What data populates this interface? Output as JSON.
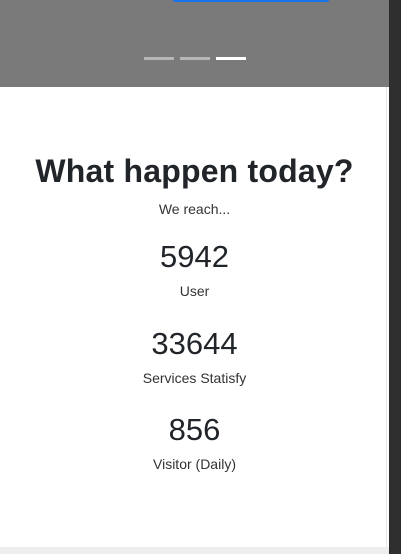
{
  "hero": {
    "slides": 3,
    "active_slide": 3
  },
  "stats": {
    "title": "What happen today?",
    "subtitle": "We reach...",
    "items": [
      {
        "value": "5942",
        "label": "User"
      },
      {
        "value": "33644",
        "label": "Services Statisfy"
      },
      {
        "value": "856",
        "label": "Visitor (Daily)"
      }
    ]
  },
  "colors": {
    "hero_bg": "#7a7a7a",
    "cta_blue": "#1a73e8",
    "text": "#212529"
  }
}
